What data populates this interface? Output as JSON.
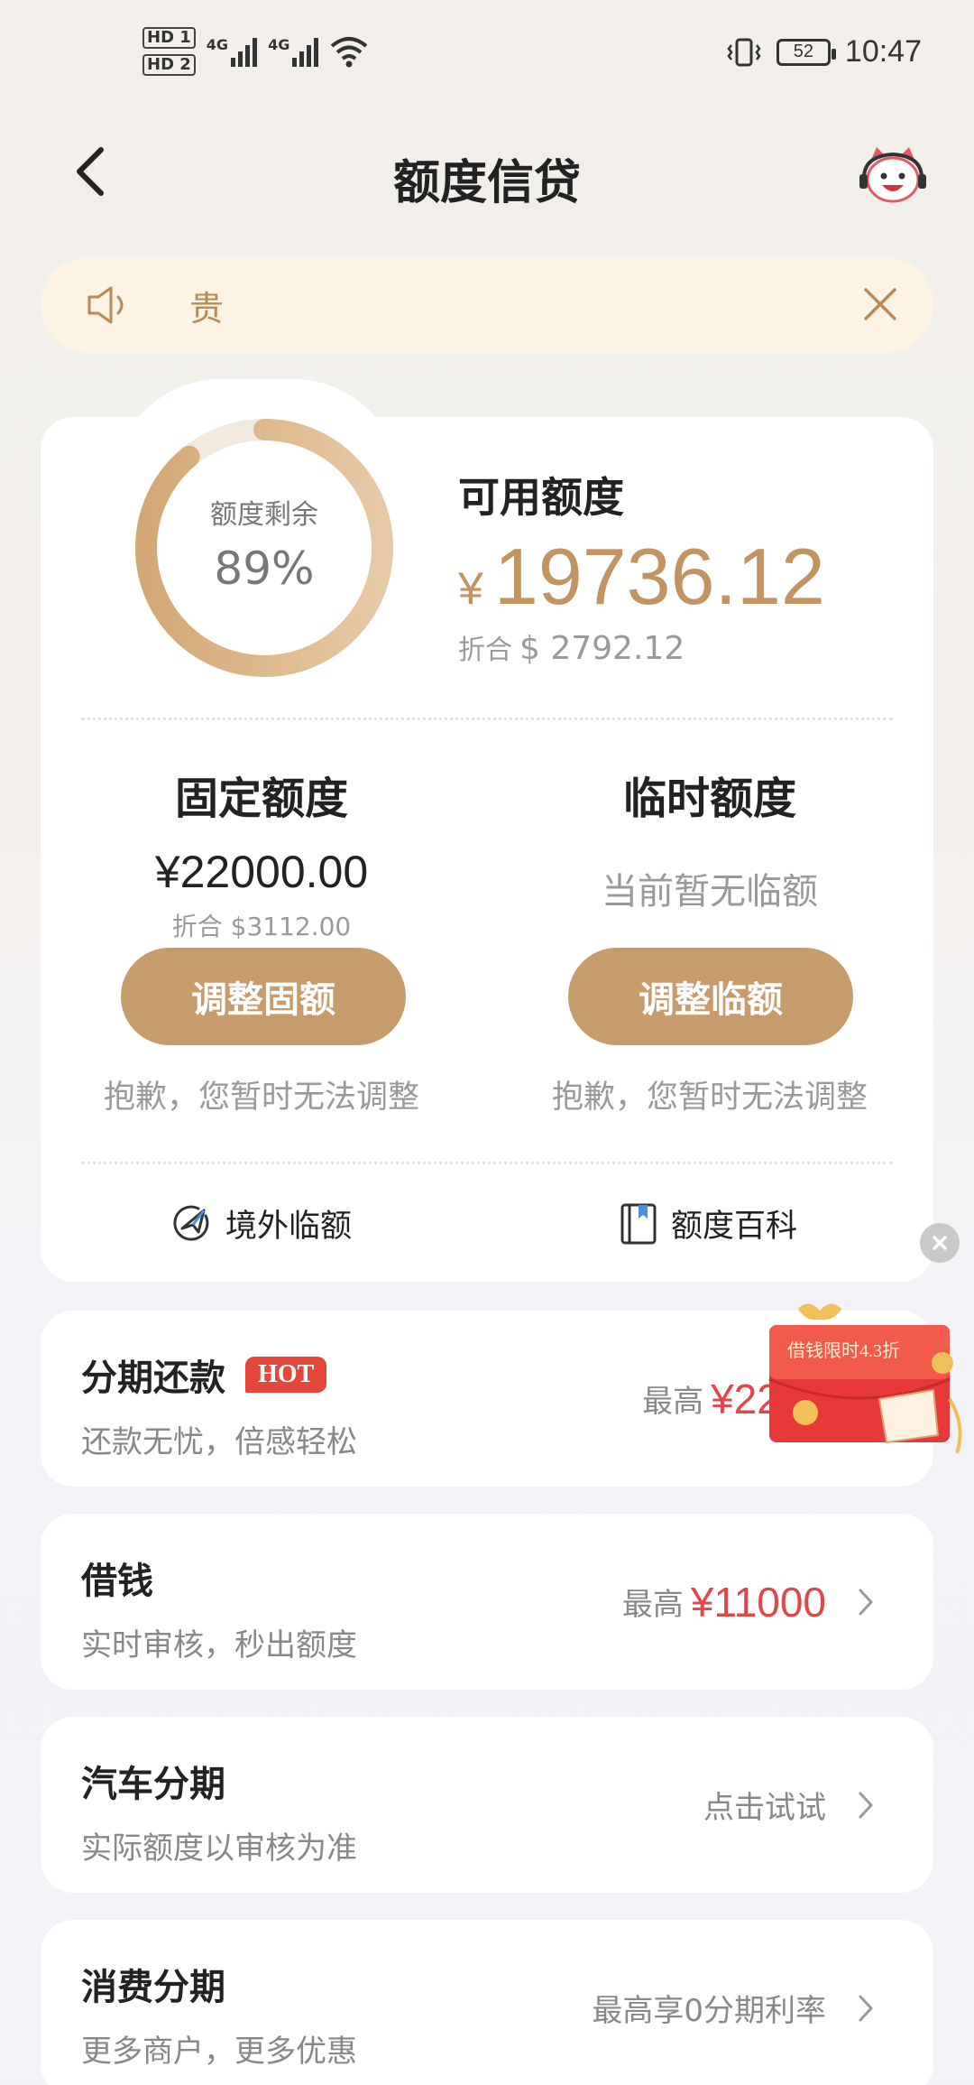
{
  "status_bar": {
    "hd1": "HD 1",
    "hd2": "HD 2",
    "net1": "4G",
    "net2": "4G",
    "battery": "52",
    "time": "10:47"
  },
  "header": {
    "title": "额度信贷"
  },
  "notice": {
    "text": "贵"
  },
  "credit": {
    "ring_label": "额度剩余",
    "ring_percent": "89%",
    "ring_fraction": 0.89,
    "available_label": "可用额度",
    "currency": "¥",
    "available_amount": "19736.12",
    "conv_label": "折合",
    "conv_amount": "$ 2792.12",
    "fixed": {
      "title": "固定额度",
      "amount": "¥22000.00",
      "conv": "折合 $3112.00",
      "button": "调整固额",
      "note": "抱歉，您暂时无法调整"
    },
    "temporary": {
      "title": "临时额度",
      "empty": "当前暂无临额",
      "button": "调整临额",
      "note": "抱歉，您暂时无法调整"
    },
    "links": {
      "overseas": "境外临额",
      "encyclopedia": "额度百科"
    }
  },
  "items": [
    {
      "title": "分期还款",
      "badge": "HOT",
      "sub": "还款无忧，倍感轻松",
      "pre": "最高",
      "amount": "¥2263"
    },
    {
      "title": "借钱",
      "sub": "实时审核，秒出额度",
      "pre": "最高",
      "amount": "¥11000"
    },
    {
      "title": "汽车分期",
      "sub": "实际额度以审核为准",
      "text": "点击试试"
    },
    {
      "title": "消费分期",
      "sub": "更多商户，更多优惠",
      "text": "最高享0分期利率"
    }
  ],
  "promo": {
    "text": "借钱限时4.3折"
  },
  "colors": {
    "accent_gold": "#c69c6d",
    "amount_red": "#e1464b",
    "notice_bg": "#fcf3e2"
  }
}
